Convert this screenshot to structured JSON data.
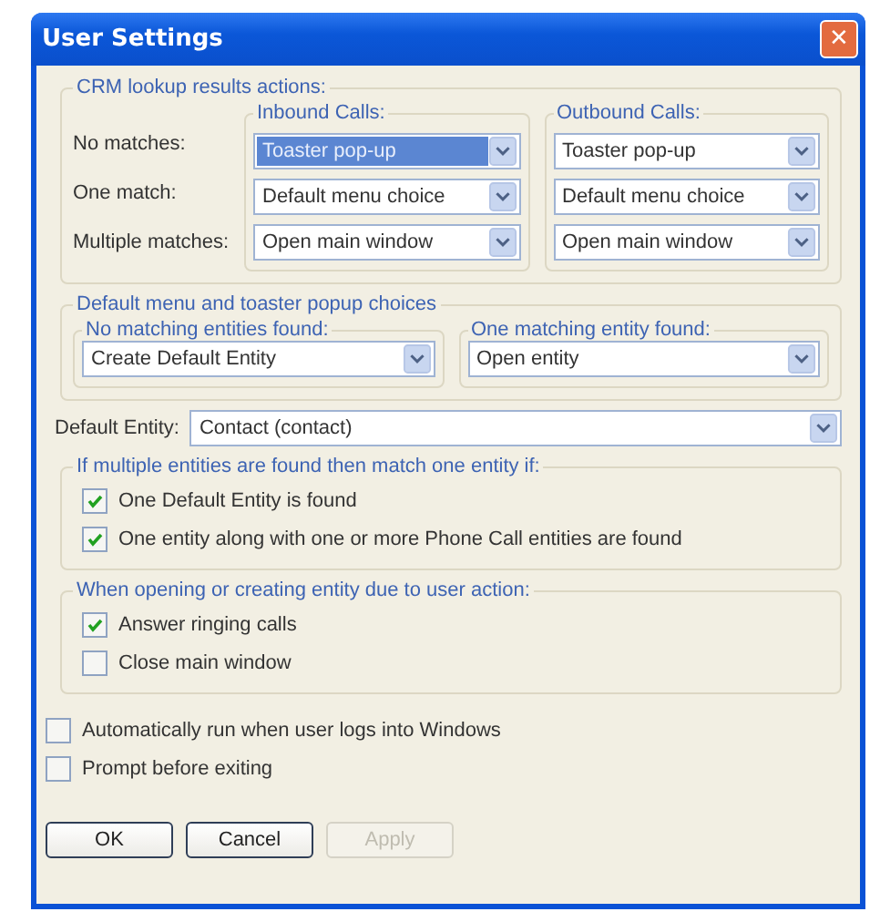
{
  "window": {
    "title": "User Settings",
    "close": "✕"
  },
  "crm_group": {
    "title": "CRM lookup results actions:",
    "columns": [
      "Inbound Calls:",
      "Outbound Calls:"
    ],
    "rows": [
      {
        "label": "No matches:",
        "choices": [
          {
            "value": "Toaster pop-up",
            "selected": true
          },
          {
            "value": "Toaster pop-up",
            "selected": false
          }
        ]
      },
      {
        "label": "One match:",
        "choices": [
          {
            "value": "Default menu choice",
            "selected": false
          },
          {
            "value": "Default menu choice",
            "selected": false
          }
        ]
      },
      {
        "label": "Multiple matches:",
        "choices": [
          {
            "value": "Open main window",
            "selected": false
          },
          {
            "value": "Open main window",
            "selected": false
          }
        ]
      }
    ]
  },
  "choices_group": {
    "title": "Default menu and toaster popup choices",
    "fields": [
      {
        "label": "No matching entities found:",
        "value": "Create Default Entity"
      },
      {
        "label": "One matching entity found:",
        "value": "Open entity"
      }
    ]
  },
  "default_entity": {
    "label": "Default Entity:",
    "value": "Contact (contact)"
  },
  "match_group": {
    "title": "If multiple entities are found then match one entity if:",
    "checkboxes": [
      {
        "label": "One Default Entity is found",
        "checked": true
      },
      {
        "label": "One entity along with one or more Phone Call entities are found",
        "checked": true
      }
    ]
  },
  "opening_group": {
    "title": "When opening or creating entity due to user action:",
    "checkboxes": [
      {
        "label": "Answer ringing calls",
        "checked": true
      },
      {
        "label": "Close main window",
        "checked": false
      }
    ]
  },
  "options": [
    {
      "label": "Automatically run when user logs into Windows",
      "checked": false
    },
    {
      "label": "Prompt before exiting",
      "checked": false
    }
  ],
  "buttons": [
    {
      "label": "OK",
      "disabled": false
    },
    {
      "label": "Cancel",
      "disabled": false
    },
    {
      "label": "Apply",
      "disabled": true
    }
  ]
}
